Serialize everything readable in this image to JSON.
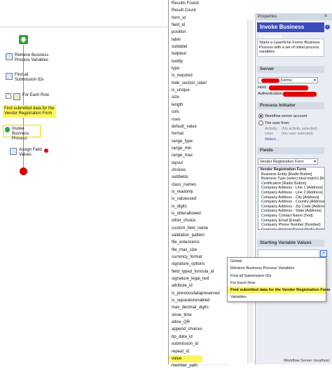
{
  "workflow": {
    "steps": [
      {
        "label": "Retrieve Business\nProcess Variables",
        "highlighted": false
      },
      {
        "label": "Find all\nSubmission IDs",
        "highlighted": false
      },
      {
        "label": "For Each Row",
        "highlighted": false
      },
      {
        "label": "Find submitted data for the\nVendor Registration Form",
        "highlighted": true
      },
      {
        "label": "Invoke Business\nProcess",
        "highlighted": true
      },
      {
        "label": "Assign Field\nValues",
        "highlighted": false
      }
    ]
  },
  "field_list": {
    "items": [
      "Results Found",
      "Result Count",
      "form_id",
      "field_id",
      "position",
      "label",
      "sublabel",
      "helptext",
      "tooltip",
      "type",
      "is_required",
      "hide_section_label",
      "is_unique",
      "size",
      "length",
      "cols",
      "rows",
      "default_value",
      "format",
      "range_type",
      "range_min",
      "range_max",
      "layout",
      "choices",
      "subfields",
      "class_names",
      "is_readonly",
      "is_valueused",
      "is_digits",
      "is_otherallowed",
      "other_choice",
      "custom_field_name",
      "validation_pattern",
      "file_extensions",
      "file_max_size",
      "currency_format",
      "signature_options",
      "field_typed_formula_id",
      "signature_legal_text",
      "attribute_id",
      "is_previousdatapreserved",
      "is_separatorenabled",
      "max_decimal_digits",
      "show_time",
      "allow_QR",
      "append_choices",
      "bp_data_id",
      "submission_id",
      "repeat_id",
      "value",
      "member_path"
    ],
    "highlighted_item": "value"
  },
  "properties": {
    "title": "Properties",
    "activity_name": "Invoke Business Process",
    "description": "Starts a Laserfiche Forms Business Process with a set of initial process variables.",
    "server": {
      "heading": "Server",
      "selected": "Forms",
      "host_label": "Host:",
      "auth_label": "Authentication:"
    },
    "initiator": {
      "heading": "Process Initiator",
      "option_service": "Workflow server account",
      "option_user": "The user from:",
      "activity_label": "Activity:",
      "activity_value": "(No activity selected)",
      "user_label": "User:",
      "user_value": "(No user selected)",
      "select_link": "Select..."
    },
    "fields": {
      "heading": "Fields",
      "selected_form": "Vendor Registration Form",
      "list_title": "Vendor Registration Form",
      "list_items": [
        "Business Entity [Radio Button]",
        "Business Type (select best match) [Radi",
        "Certification [Radio Button]",
        "Company Address - Line 1 [Address]",
        "Company Address - Line 2 [Address]",
        "Company Address - City [Address]",
        "Company Address - Country [Address]",
        "Company Address - Zip Code [Address]",
        "Company Address - State [Address]",
        "Company Contact Name [Text]",
        "Company Email [Email]",
        "Company Phone Number [Number]",
        "Company Website/Social Media Page [L"
      ]
    },
    "starting_vars": {
      "heading": "Starting Variable Values"
    }
  },
  "context_menu": {
    "items": [
      "Global",
      "Retrieve Business Process Variables",
      "Find all Submission IDs",
      "For Each Row",
      "Find submitted data for the Vendor Registration Form",
      "Variables"
    ],
    "highlighted_item": "Find submitted data for the Vendor Registration Form"
  },
  "status_bar": {
    "text": "Workflow Server: localhost"
  },
  "colors": {
    "highlight": "#fdf65a",
    "header_blue": "#3b4bbf",
    "redaction": "#e00000",
    "start_green": "#2e9e3a",
    "end_red": "#d40000"
  }
}
